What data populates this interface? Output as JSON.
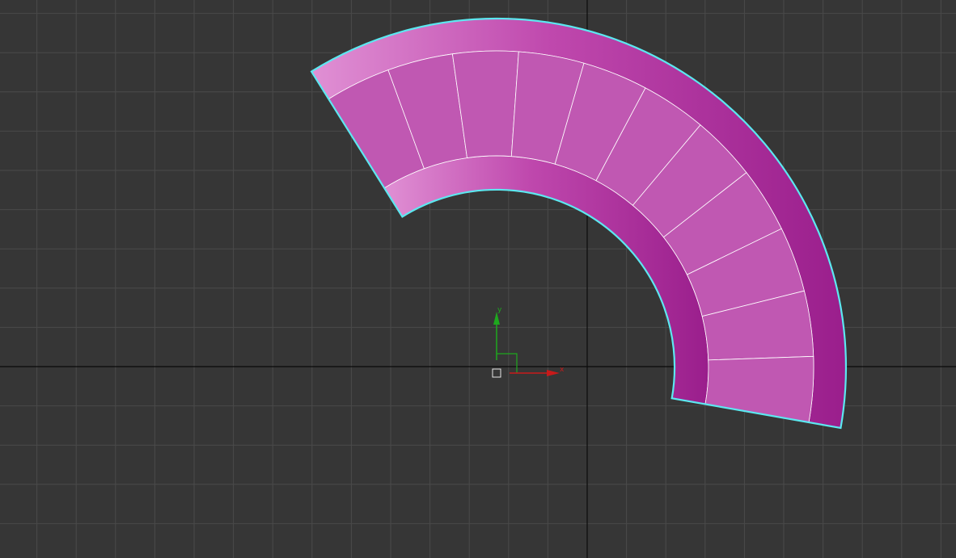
{
  "viewport": {
    "background": "#363636",
    "grid_color": "#4a4a4a",
    "home_grid_axis_color": "#0b0b0b"
  },
  "selected_object": {
    "type": "spiral-stair",
    "selected": true,
    "selection_outline_color": "#5ce8f0",
    "step_color": "#c058b2",
    "stringer_gradient": [
      "#e090d4",
      "#bf48ad",
      "#9a1e8c"
    ],
    "step_divider_color": "#ffffff",
    "step_count": 11
  },
  "gizmo": {
    "x_axis_label": "x",
    "y_axis_label": "y",
    "x_axis_color": "#c81a1a",
    "y_axis_color": "#1ea81e",
    "pivot_icon": "pivot-square-icon"
  }
}
